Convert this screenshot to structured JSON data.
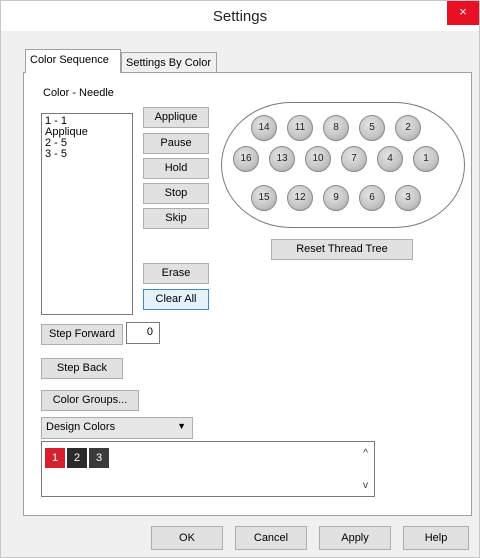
{
  "window": {
    "title": "Settings",
    "close_glyph": "×"
  },
  "tabs": [
    "Color Sequence",
    "Settings By Color"
  ],
  "color_needle": {
    "label": "Color - Needle",
    "items": [
      "1  -  1",
      "Applique",
      "2  -  5",
      "3  -  5"
    ]
  },
  "side_buttons": {
    "applique": "Applique",
    "pause": "Pause",
    "hold": "Hold",
    "stop": "Stop",
    "skip": "Skip",
    "erase": "Erase",
    "clear_all": "Clear All"
  },
  "thread_tree": {
    "rows": [
      [
        "14",
        "11",
        "8",
        "5",
        "2"
      ],
      [
        "16",
        "13",
        "10",
        "7",
        "4",
        "1"
      ],
      [
        "15",
        "12",
        "9",
        "6",
        "3"
      ]
    ],
    "reset_label": "Reset Thread Tree"
  },
  "step": {
    "forward_label": "Step Forward",
    "forward_value": "0",
    "back_label": "Step Back"
  },
  "color_groups_label": "Color Groups...",
  "design_colors": {
    "selected": "Design Colors",
    "swatches": [
      {
        "label": "1",
        "color": "#d6202e"
      },
      {
        "label": "2",
        "color": "#2b2b2b"
      },
      {
        "label": "3",
        "color": "#3a3a3a"
      }
    ],
    "scroll_up": "^",
    "scroll_down": "v"
  },
  "footer": {
    "ok": "OK",
    "cancel": "Cancel",
    "apply": "Apply",
    "help": "Help"
  }
}
